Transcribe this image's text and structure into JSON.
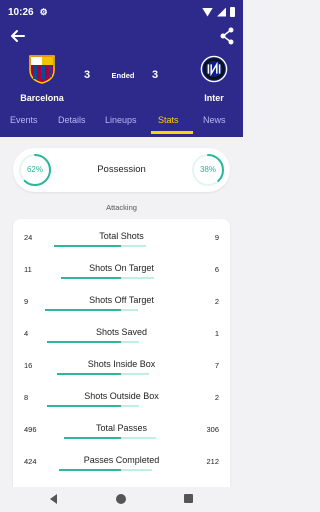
{
  "status_bar": {
    "time": "10:26"
  },
  "match": {
    "home": {
      "name": "Barcelona",
      "score": "3"
    },
    "away": {
      "name": "Inter",
      "score": "3"
    },
    "status": "Ended"
  },
  "tabs": [
    {
      "label": "Events"
    },
    {
      "label": "Details"
    },
    {
      "label": "Lineups"
    },
    {
      "label": "Stats",
      "active": true
    },
    {
      "label": "News"
    }
  ],
  "possession": {
    "title": "Possession",
    "home": "62%",
    "away": "38%",
    "home_value": 62,
    "away_value": 38
  },
  "section_title": "Attacking",
  "stats": [
    {
      "label": "Total Shots",
      "home": "24",
      "away": "9"
    },
    {
      "label": "Shots On Target",
      "home": "11",
      "away": "6"
    },
    {
      "label": "Shots Off Target",
      "home": "9",
      "away": "2"
    },
    {
      "label": "Shots Saved",
      "home": "4",
      "away": "1"
    },
    {
      "label": "Shots Inside Box",
      "home": "16",
      "away": "7"
    },
    {
      "label": "Shots Outside Box",
      "home": "8",
      "away": "2"
    },
    {
      "label": "Total Passes",
      "home": "496",
      "away": "306"
    },
    {
      "label": "Passes Completed",
      "home": "424",
      "away": "212"
    }
  ],
  "colors": {
    "header": "#2e2a8c",
    "accent": "#ffd400",
    "stat_bar_home": "#2ab79b",
    "stat_bar_away": "#bfeee2"
  },
  "icons": {
    "back": "arrow-left-icon",
    "share": "share-icon",
    "home_crest": "barcelona-crest-icon",
    "away_crest": "inter-crest-icon"
  }
}
